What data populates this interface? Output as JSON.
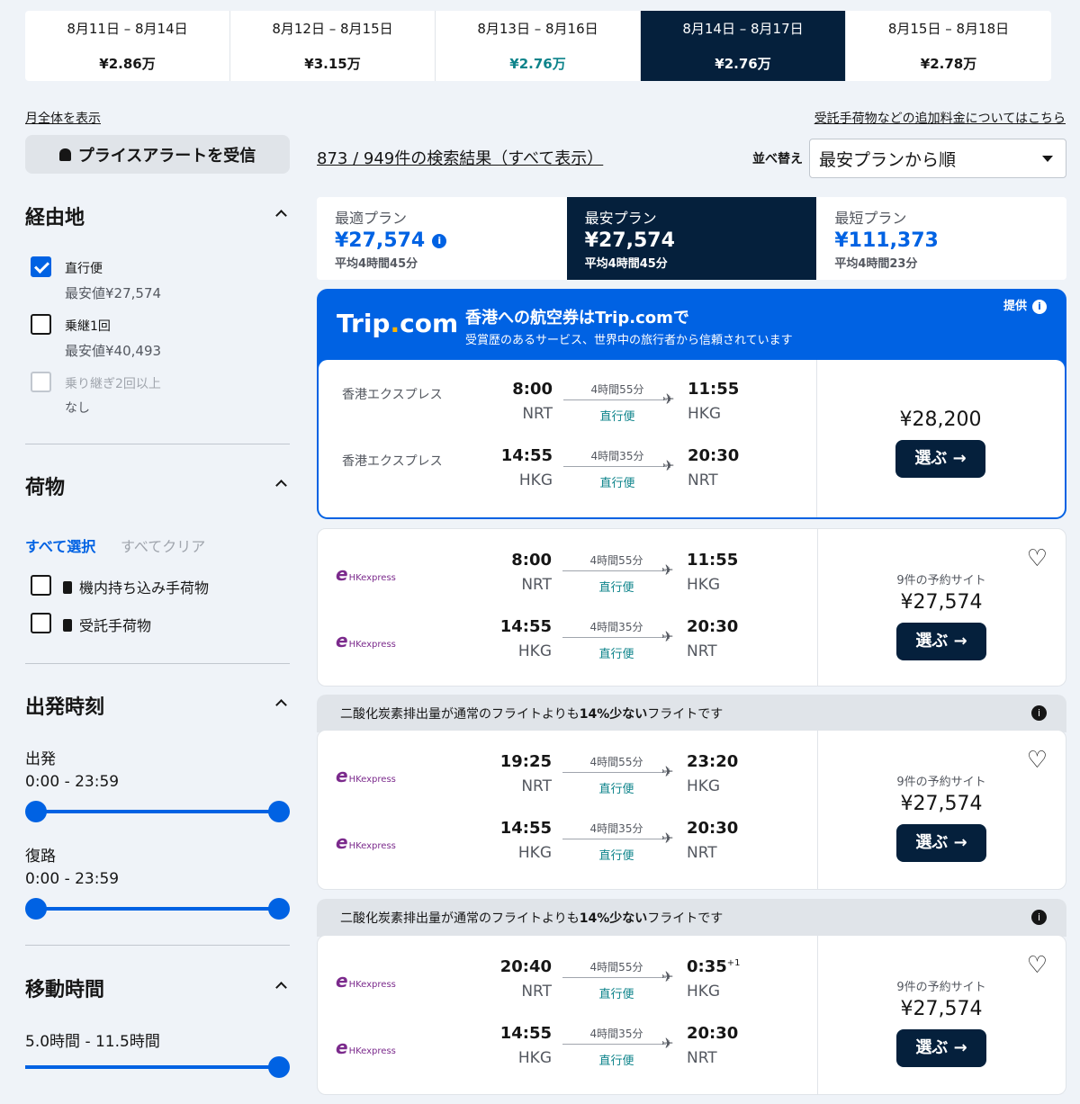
{
  "dates": [
    {
      "range": "8月11日 – 8月14日",
      "price": "¥2.86万",
      "style": "normal"
    },
    {
      "range": "8月12日 – 8月15日",
      "price": "¥3.15万",
      "style": "normal"
    },
    {
      "range": "8月13日 – 8月16日",
      "price": "¥2.76万",
      "style": "green"
    },
    {
      "range": "8月14日 – 8月17日",
      "price": "¥2.76万",
      "style": "selected"
    },
    {
      "range": "8月15日 – 8月18日",
      "price": "¥2.78万",
      "style": "normal"
    }
  ],
  "month_link": "月全体を表示",
  "fees_link": "受託手荷物などの追加料金についてはこちら",
  "alert_button": "プライスアラートを受信",
  "filters": {
    "stops": {
      "title": "経由地",
      "items": [
        {
          "label": "直行便",
          "sub": "最安値¥27,574",
          "checked": true
        },
        {
          "label": "乗継1回",
          "sub": "最安値¥40,493",
          "checked": false
        },
        {
          "label": "乗り継ぎ2回以上",
          "sub": "なし",
          "checked": false,
          "disabled": true
        }
      ]
    },
    "baggage": {
      "title": "荷物",
      "select_all": "すべて選択",
      "clear_all": "すべてクリア",
      "items": [
        "機内持ち込み手荷物",
        "受託手荷物"
      ]
    },
    "departure": {
      "title": "出発時刻",
      "out_label": "出発",
      "out_range": "0:00 - 23:59",
      "ret_label": "復路",
      "ret_range": "0:00 - 23:59"
    },
    "duration": {
      "title": "移動時間",
      "range": "5.0時間 - 11.5時間"
    }
  },
  "results_text": "873 / 949件の検索結果（すべて表示）",
  "sort": {
    "label": "並べ替え",
    "value": "最安プランから順"
  },
  "tabs": [
    {
      "title": "最適プラン",
      "price": "¥27,574",
      "avg": "平均4時間45分",
      "selected": false
    },
    {
      "title": "最安プラン",
      "price": "¥27,574",
      "avg": "平均4時間45分",
      "selected": true
    },
    {
      "title": "最短プラン",
      "price": "¥111,373",
      "avg": "平均4時間23分",
      "selected": false
    }
  ],
  "ad": {
    "logo_main": "Trip",
    "logo_dot": ".",
    "logo_tail": "com",
    "headline": "香港への航空券はTrip.comで",
    "subline": "受賞歴のあるサービス、世界中の旅行者から信頼されています",
    "provided": "提供"
  },
  "ad_flight": {
    "price": "¥28,200",
    "button": "選ぶ",
    "legs": [
      {
        "airline": "香港エクスプレス",
        "dep": "8:00",
        "from": "NRT",
        "dur": "4時間55分",
        "direct": "直行便",
        "arr": "11:55",
        "to": "HKG"
      },
      {
        "airline": "香港エクスプレス",
        "dep": "14:55",
        "from": "HKG",
        "dur": "4時間35分",
        "direct": "直行便",
        "arr": "20:30",
        "to": "NRT"
      }
    ]
  },
  "co2_pre": "二酸化炭素排出量が通常のフライトよりも",
  "co2_bold": "14%少ない",
  "co2_post": "フライトです",
  "logo_text": "HKexpress",
  "flights": [
    {
      "sites": "9件の予約サイト",
      "price": "¥27,574",
      "button": "選ぶ",
      "legs": [
        {
          "dep": "8:00",
          "from": "NRT",
          "dur": "4時間55分",
          "direct": "直行便",
          "arr": "11:55",
          "to": "HKG"
        },
        {
          "dep": "14:55",
          "from": "HKG",
          "dur": "4時間35分",
          "direct": "直行便",
          "arr": "20:30",
          "to": "NRT"
        }
      ]
    },
    {
      "sites": "9件の予約サイト",
      "price": "¥27,574",
      "button": "選ぶ",
      "legs": [
        {
          "dep": "19:25",
          "from": "NRT",
          "dur": "4時間55分",
          "direct": "直行便",
          "arr": "23:20",
          "to": "HKG"
        },
        {
          "dep": "14:55",
          "from": "HKG",
          "dur": "4時間35分",
          "direct": "直行便",
          "arr": "20:30",
          "to": "NRT"
        }
      ]
    },
    {
      "sites": "9件の予約サイト",
      "price": "¥27,574",
      "button": "選ぶ",
      "legs": [
        {
          "dep": "20:40",
          "from": "NRT",
          "dur": "4時間55分",
          "direct": "直行便",
          "arr": "0:35",
          "next": "+1",
          "to": "HKG"
        },
        {
          "dep": "14:55",
          "from": "HKG",
          "dur": "4時間35分",
          "direct": "直行便",
          "arr": "20:30",
          "to": "NRT"
        }
      ]
    }
  ]
}
